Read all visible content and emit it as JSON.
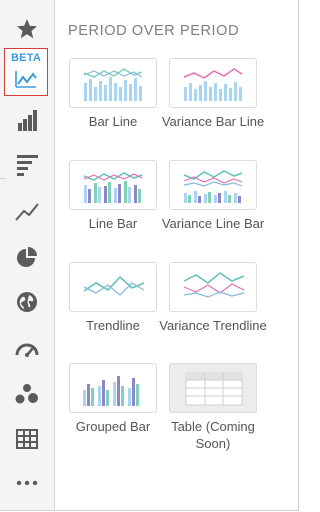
{
  "panel": {
    "section_title": "PERIOD OVER PERIOD"
  },
  "rail": {
    "items": [
      {
        "icon": "star-icon"
      },
      {
        "icon": "beta-chart-icon",
        "badge": "BETA",
        "selected": true
      },
      {
        "icon": "bar-chart-icon"
      },
      {
        "icon": "horizontal-bar-icon"
      },
      {
        "icon": "line-chart-icon"
      },
      {
        "icon": "pie-chart-icon"
      },
      {
        "icon": "globe-icon"
      },
      {
        "icon": "gauge-icon"
      },
      {
        "icon": "bubble-icon"
      },
      {
        "icon": "table-grid-icon"
      },
      {
        "icon": "more-icon"
      }
    ],
    "accent": "#d93a3a",
    "icon_color": "#5b5b5b",
    "beta_color": "#3b9ad9"
  },
  "charts": [
    {
      "label": "Bar Line",
      "icon": "bar-line-chart-icon"
    },
    {
      "label": "Variance Bar Line",
      "icon": "variance-bar-line-chart-icon"
    },
    {
      "label": "Line Bar",
      "icon": "line-bar-chart-icon"
    },
    {
      "label": "Variance Line Bar",
      "icon": "variance-line-bar-chart-icon"
    },
    {
      "label": "Trendline",
      "icon": "trendline-chart-icon"
    },
    {
      "label": "Variance Trendline",
      "icon": "variance-trendline-chart-icon"
    },
    {
      "label": "Grouped Bar",
      "icon": "grouped-bar-chart-icon"
    },
    {
      "label": "Table (Coming Soon)",
      "icon": "table-icon",
      "disabled": true
    }
  ],
  "palette": {
    "bar_blue": "#a9d4f2",
    "bar_purple": "#8f86c6",
    "bar_green": "#7fd2b6",
    "line_teal": "#5fc3b7",
    "line_pink": "#e56fb2",
    "line_blue": "#86b9df"
  }
}
